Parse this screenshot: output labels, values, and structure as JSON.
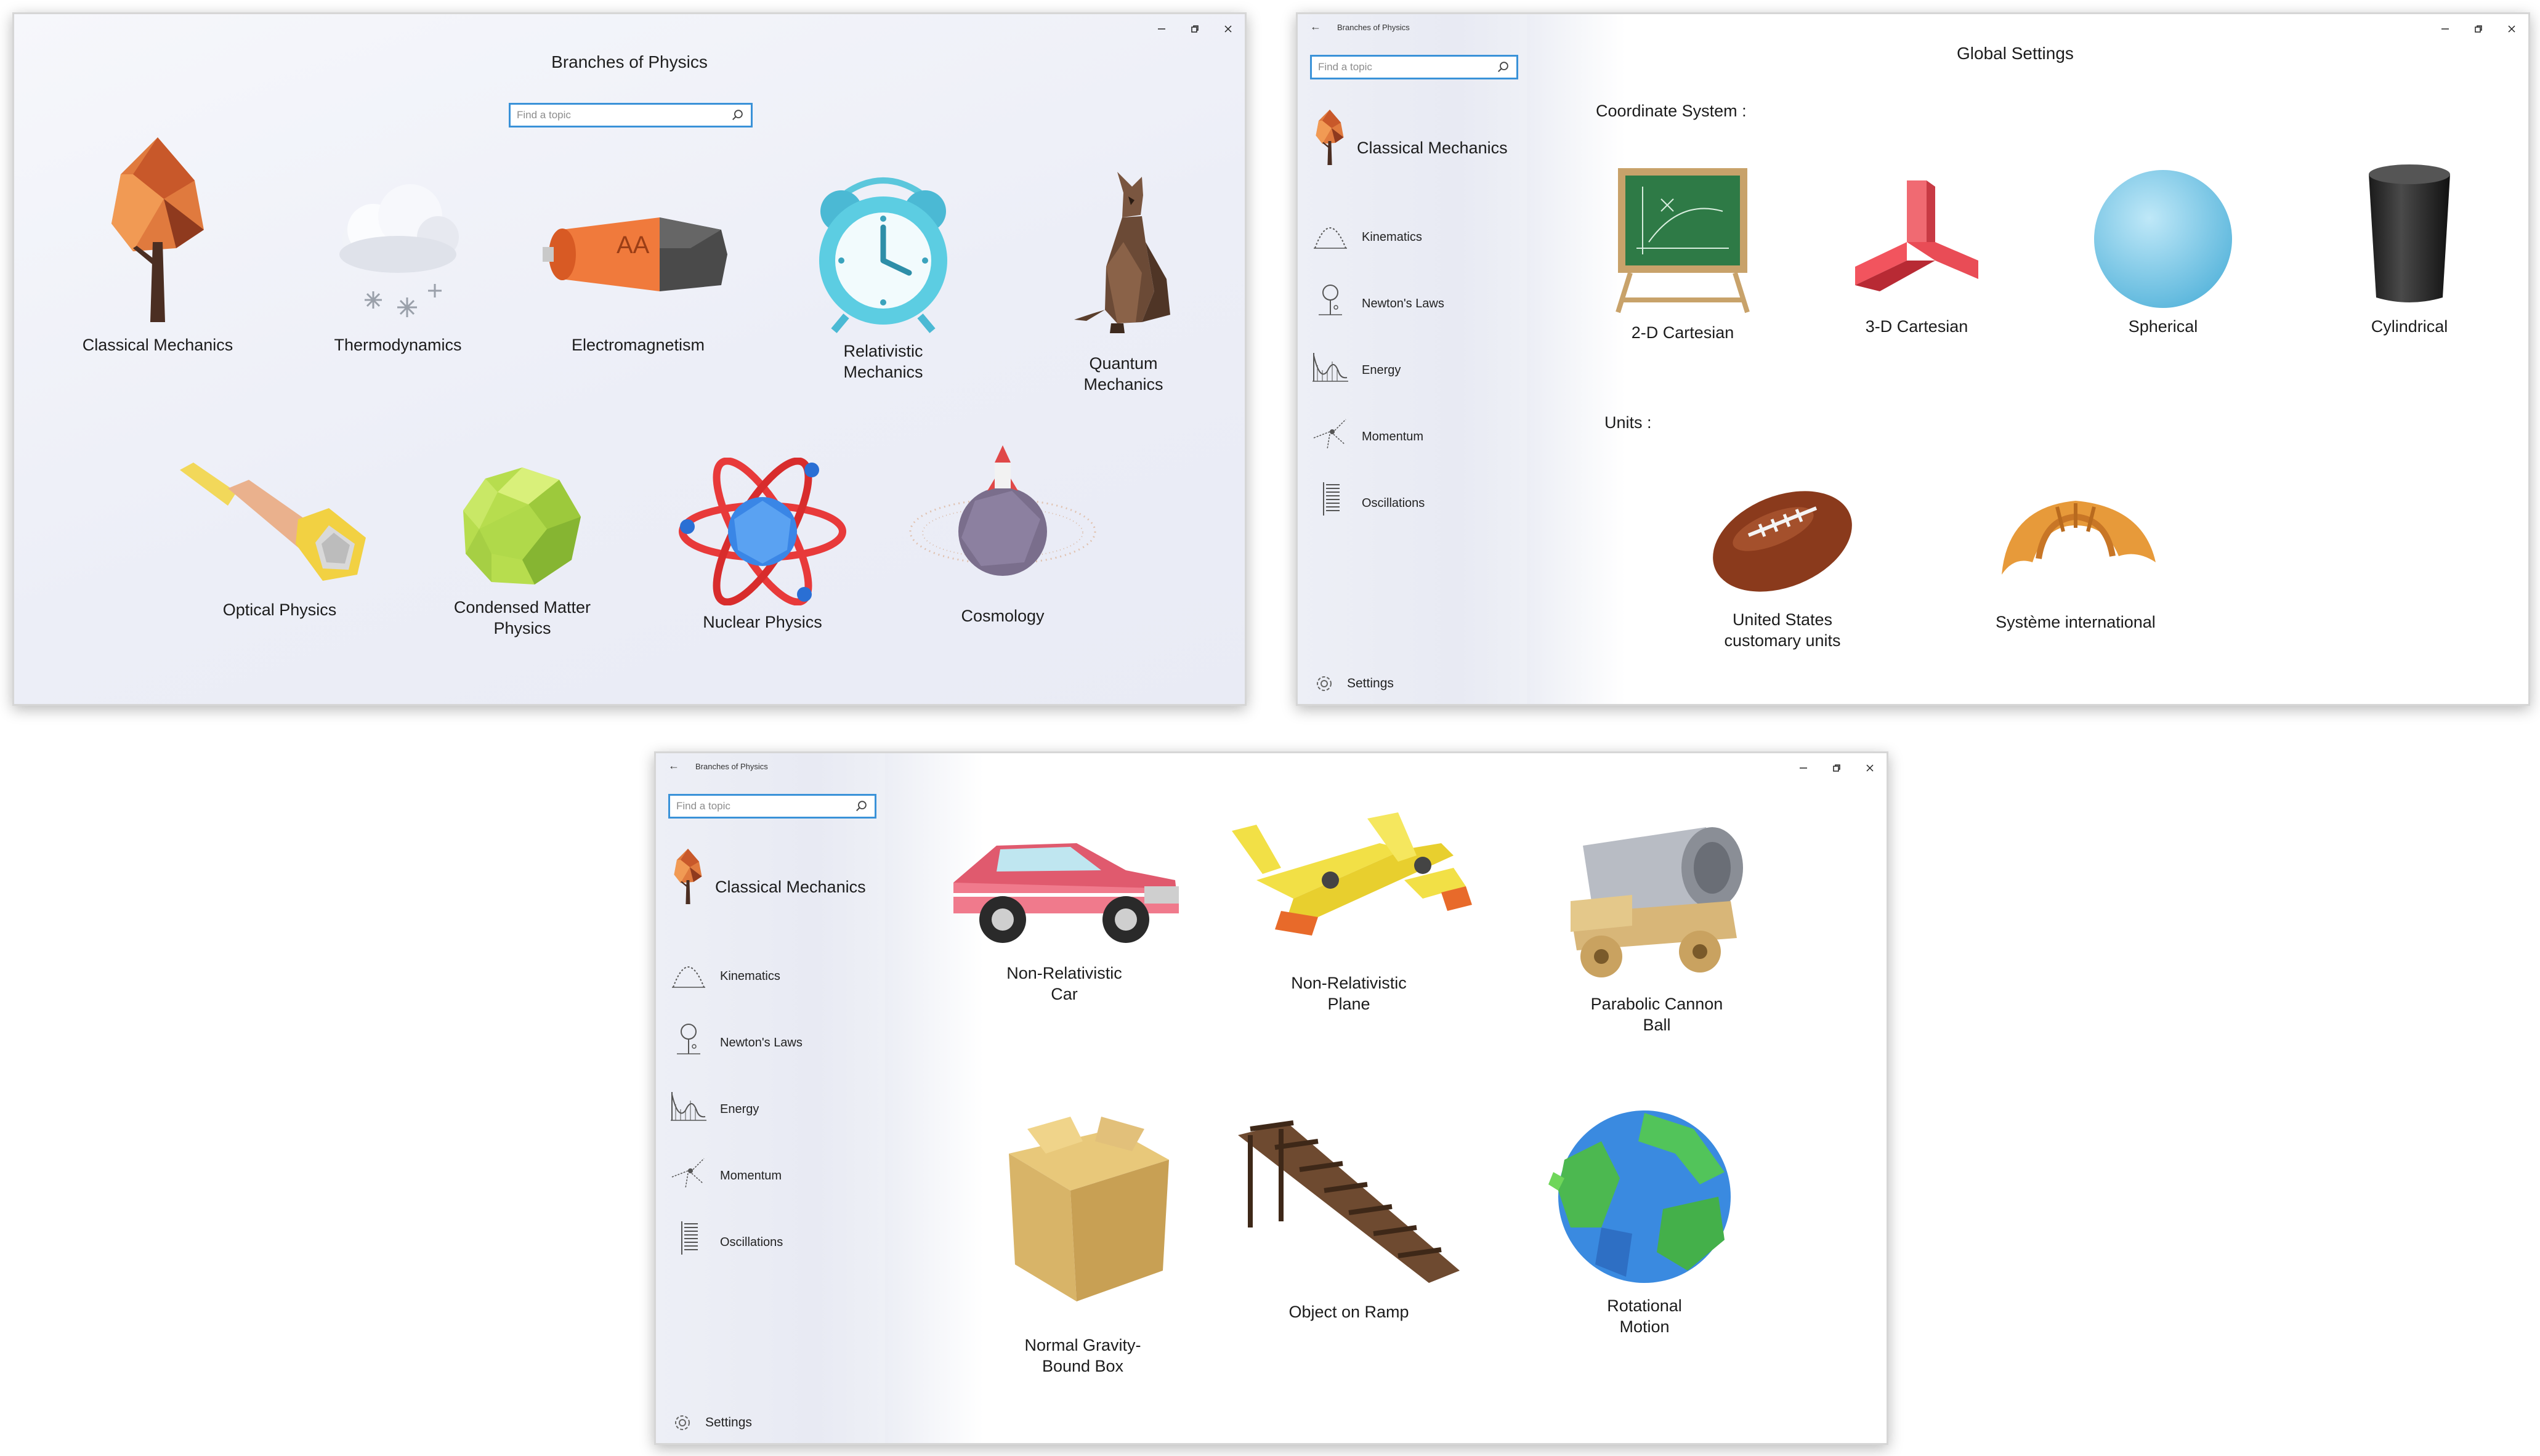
{
  "app_title": "Branches of Physics",
  "search_placeholder": "Find a topic",
  "caption_buttons": {
    "minimize": "‒",
    "restore": "❐",
    "close": "✕"
  },
  "home": {
    "title": "Branches of Physics",
    "tiles": [
      {
        "label": "Classical Mechanics",
        "icon": "tree-icon"
      },
      {
        "label": "Thermodynamics",
        "icon": "snow-cloud-icon"
      },
      {
        "label": "Electromagnetism",
        "icon": "battery-icon"
      },
      {
        "label_lines": [
          "Relativistic",
          "Mechanics"
        ],
        "icon": "alarm-clock-icon"
      },
      {
        "label_lines": [
          "Quantum",
          "Mechanics"
        ],
        "icon": "cat-icon"
      },
      {
        "label": "Optical Physics",
        "icon": "telescope-icon"
      },
      {
        "label_lines": [
          "Condensed Matter",
          "Physics"
        ],
        "icon": "crystal-ball-icon"
      },
      {
        "label": "Nuclear Physics",
        "icon": "atom-icon"
      },
      {
        "label": "Cosmology",
        "icon": "planet-icon"
      }
    ]
  },
  "nav": {
    "section_title": "Classical Mechanics",
    "items": [
      {
        "label": "Kinematics",
        "icon": "projectile-arc-icon"
      },
      {
        "label": "Newton's Laws",
        "icon": "apple-tree-icon"
      },
      {
        "label": "Energy",
        "icon": "roller-coaster-icon"
      },
      {
        "label": "Momentum",
        "icon": "collision-icon"
      },
      {
        "label": "Oscillations",
        "icon": "spring-icon"
      }
    ],
    "settings_label": "Settings"
  },
  "settings_page": {
    "title": "Global Settings",
    "coordinate_label": "Coordinate System :",
    "coordinate_options": [
      {
        "label": "2-D Cartesian",
        "icon": "chalkboard-icon"
      },
      {
        "label": "3-D Cartesian",
        "icon": "axes-3d-icon"
      },
      {
        "label": "Spherical",
        "icon": "sphere-icon"
      },
      {
        "label": "Cylindrical",
        "icon": "cylinder-icon"
      }
    ],
    "units_label": "Units :",
    "unit_options": [
      {
        "label_lines": [
          "United States",
          "customary units"
        ],
        "icon": "football-icon"
      },
      {
        "label": "Système international",
        "icon": "croissant-icon"
      }
    ]
  },
  "classical_page": {
    "tiles": [
      {
        "label_lines": [
          "Non-Relativistic",
          "Car"
        ],
        "icon": "car-icon"
      },
      {
        "label_lines": [
          "Non-Relativistic",
          "Plane"
        ],
        "icon": "plane-icon"
      },
      {
        "label_lines": [
          "Parabolic Cannon",
          "Ball"
        ],
        "icon": "cannon-icon"
      },
      {
        "label_lines": [
          "Normal Gravity-",
          "Bound Box"
        ],
        "icon": "box-icon"
      },
      {
        "label": "Object on Ramp",
        "icon": "ramp-icon"
      },
      {
        "label_lines": [
          "Rotational",
          "Motion"
        ],
        "icon": "globe-icon"
      }
    ]
  },
  "colors": {
    "accent": "#3a92d8",
    "pane": "#eceef5"
  }
}
